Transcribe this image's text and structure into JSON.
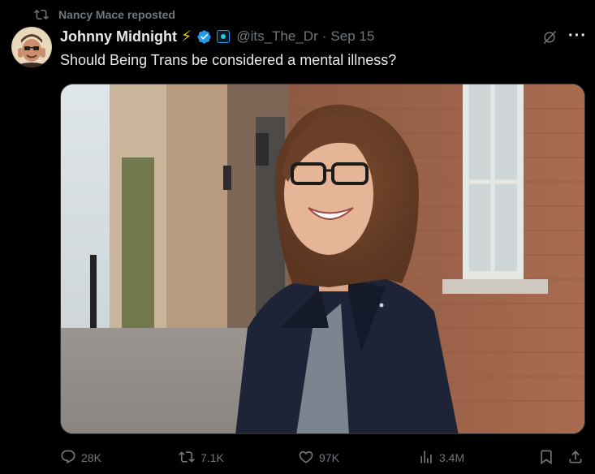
{
  "repost": {
    "icon": "repost-icon",
    "text": "Nancy Mace reposted"
  },
  "author": {
    "name": "Johnny Midnight",
    "emoji": "⚡",
    "verified_icon": "verified-badge-icon",
    "affiliate_icon": "affiliate-badge-icon",
    "handle": "@its_The_Dr",
    "separator": "·",
    "date": "Sep 15",
    "avatar_icon": "avatar-image"
  },
  "tweet": {
    "text": "Should Being Trans be considered a mental illness?"
  },
  "media": {
    "description_icon": "photo-image"
  },
  "header_actions": {
    "grok_icon": "grok-icon",
    "more_label": "···"
  },
  "actions": {
    "reply": {
      "icon": "reply-icon",
      "count": "28K"
    },
    "repost": {
      "icon": "repost-icon",
      "count": "7.1K"
    },
    "like": {
      "icon": "heart-icon",
      "count": "97K"
    },
    "views": {
      "icon": "views-icon",
      "count": "3.4M"
    },
    "bookmark": {
      "icon": "bookmark-icon"
    },
    "share": {
      "icon": "share-icon"
    }
  },
  "colors": {
    "background": "#000000",
    "text": "#e7e9ea",
    "muted": "#71767b",
    "verified_blue": "#1d9bf0",
    "bolt_yellow": "#f4c20d"
  }
}
